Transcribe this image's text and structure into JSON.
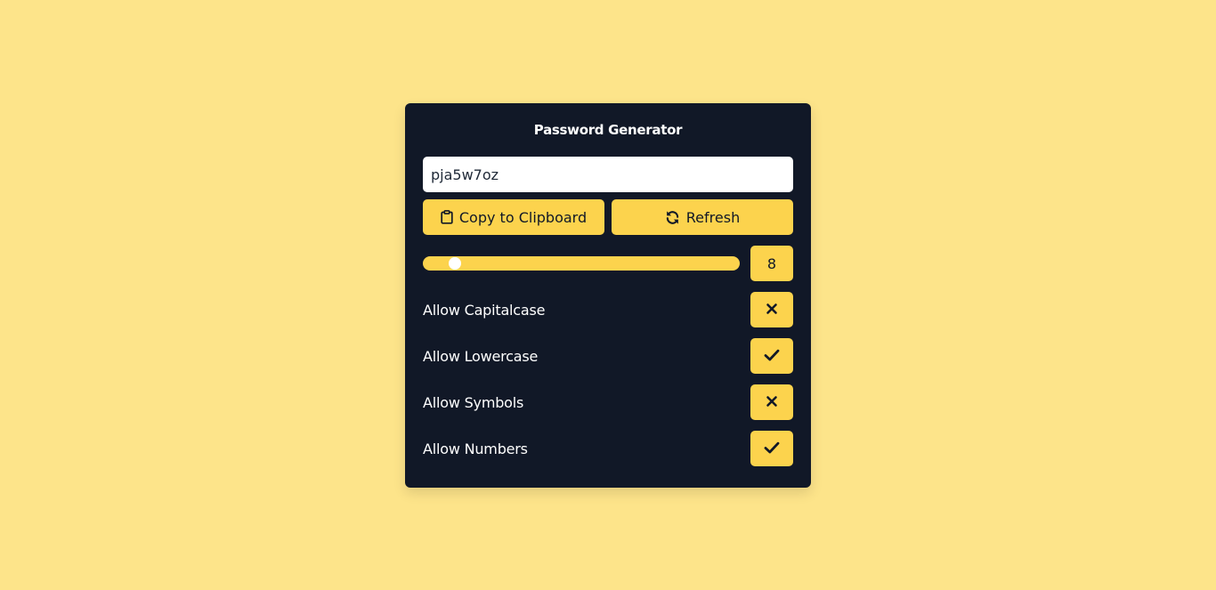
{
  "app": {
    "title": "Password Generator",
    "background_color": "#fde48a",
    "card_color": "#111827",
    "accent_color": "#fcd34d"
  },
  "password": {
    "value": "pja5w7oz"
  },
  "actions": {
    "copy_label": "Copy to Clipboard",
    "copy_icon": "clipboard-icon",
    "refresh_label": "Refresh",
    "refresh_icon": "refresh-icon"
  },
  "length": {
    "value": "8",
    "slider_fraction": 0.08
  },
  "options": [
    {
      "label": "Allow Capitalcase",
      "enabled": false,
      "icon": "close-icon"
    },
    {
      "label": "Allow Lowercase",
      "enabled": true,
      "icon": "check-icon"
    },
    {
      "label": "Allow Symbols",
      "enabled": false,
      "icon": "close-icon"
    },
    {
      "label": "Allow Numbers",
      "enabled": true,
      "icon": "check-icon"
    }
  ]
}
